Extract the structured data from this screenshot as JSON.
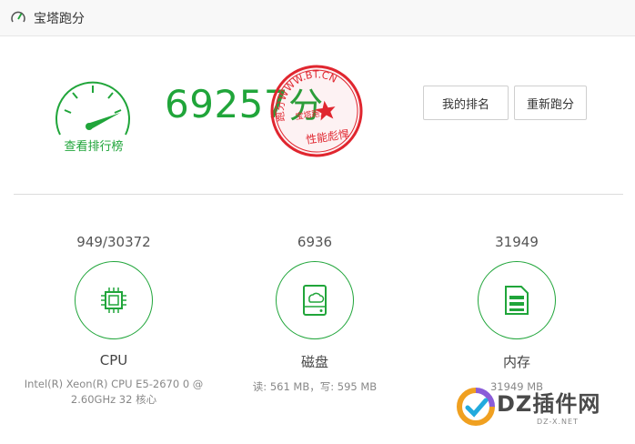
{
  "window": {
    "title": "宝塔跑分",
    "icon": "speedometer-icon"
  },
  "gauge": {
    "label": "查看排行榜",
    "icon": "gauge-icon"
  },
  "score": {
    "value": "69257",
    "unit": "分"
  },
  "stamp": {
    "arc_text": "跑分WWW.BT.CN",
    "center_text": "宝塔跑分",
    "bottom_text": "性能彪悍",
    "color": "#e0262f"
  },
  "buttons": {
    "rank": "我的排名",
    "rerun": "重新跑分"
  },
  "metrics": {
    "cpu": {
      "value": "949/30372",
      "name": "CPU",
      "desc_line1": "Intel(R) Xeon(R) CPU E5-2670 0 @",
      "desc_line2": "2.60GHz 32 核心",
      "icon": "cpu-chip-icon"
    },
    "disk": {
      "value": "6936",
      "name": "磁盘",
      "desc_line1": "读: 561 MB，写: 595 MB",
      "icon": "disk-drive-icon"
    },
    "mem": {
      "value": "31949",
      "name": "内存",
      "desc_line1": "31949 MB",
      "icon": "memory-doc-icon"
    }
  },
  "watermark": {
    "text": "DZ插件网",
    "sub": "DZ-X.NET"
  },
  "colors": {
    "accent": "#20a53a",
    "stamp": "#e0262f"
  }
}
